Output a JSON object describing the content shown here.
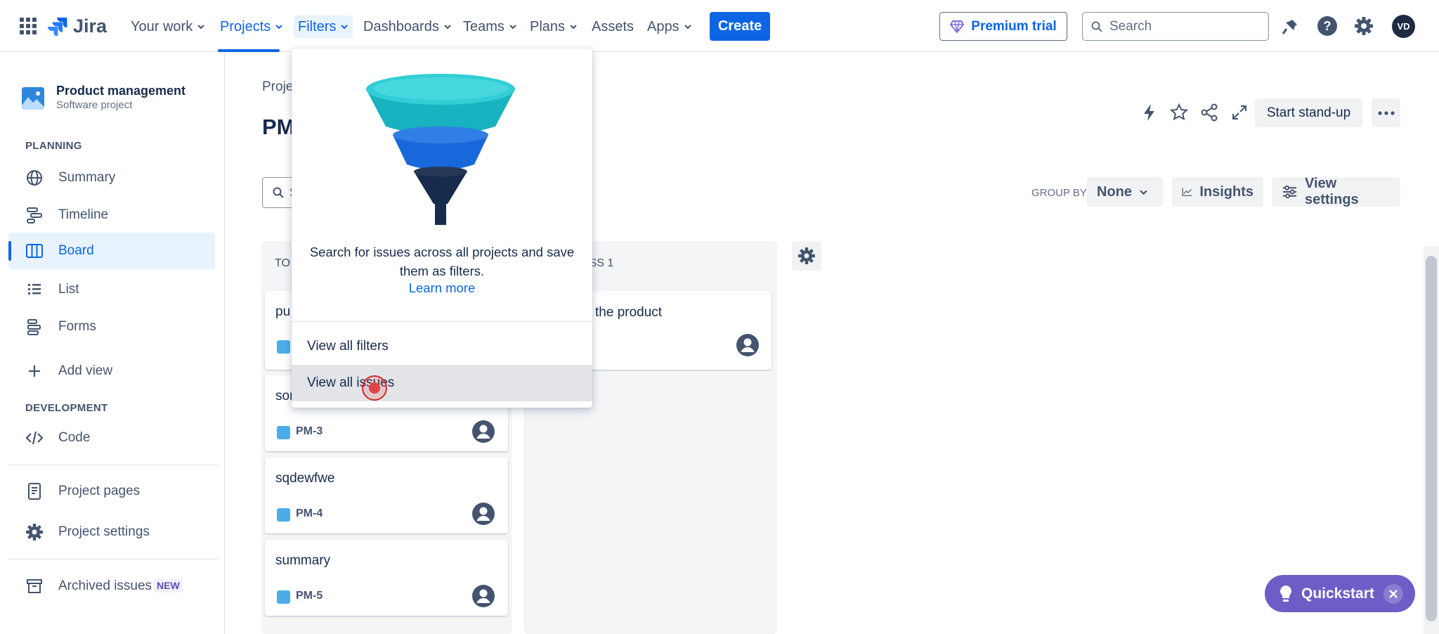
{
  "topnav": {
    "logo_text": "Jira",
    "items": [
      {
        "label": "Your work",
        "chevron": true
      },
      {
        "label": "Projects",
        "chevron": true
      },
      {
        "label": "Filters",
        "chevron": true
      },
      {
        "label": "Dashboards",
        "chevron": true
      },
      {
        "label": "Teams",
        "chevron": true
      },
      {
        "label": "Plans",
        "chevron": true
      },
      {
        "label": "Assets",
        "chevron": false
      },
      {
        "label": "Apps",
        "chevron": true
      }
    ],
    "create_label": "Create",
    "premium_label": "Premium trial",
    "search_placeholder": "Search",
    "avatar_initials": "VD"
  },
  "sidebar": {
    "project_name": "Product management",
    "project_type": "Software project",
    "planning_heading": "PLANNING",
    "planning_items": [
      "Summary",
      "Timeline",
      "Board",
      "List",
      "Forms"
    ],
    "add_view_label": "Add view",
    "development_heading": "DEVELOPMENT",
    "code_label": "Code",
    "project_pages_label": "Project pages",
    "project_settings_label": "Project settings",
    "archived_label": "Archived issues",
    "new_badge": "NEW"
  },
  "main": {
    "breadcrumb": "Proje",
    "title": "PM",
    "search_placeholder": "S",
    "start_standup": "Start stand-up",
    "group_by_label": "GROUP BY",
    "group_by_value": "None",
    "insights_label": "Insights",
    "view_settings_label": "View settings",
    "col1_title": "TO",
    "col2_title": "ESS 1",
    "col2_card_title": "the product",
    "cards": [
      {
        "title": "pu",
        "key": ""
      },
      {
        "title": "sor",
        "key": "PM-3"
      },
      {
        "title": "sqdewfwe",
        "key": "PM-4"
      },
      {
        "title": "summary",
        "key": "PM-5"
      }
    ]
  },
  "filters_dropdown": {
    "description": "Search for issues across all projects and save them as filters.",
    "learn_more": "Learn more",
    "items": [
      "View all filters",
      "View all issues"
    ]
  },
  "quickstart_label": "Quickstart",
  "colors": {
    "brand_blue": "#0c66e4",
    "quickstart_purple": "#6e5dc6",
    "board_column_bg": "#f4f5f7",
    "selected_nav_bg": "#e9f2ff"
  }
}
